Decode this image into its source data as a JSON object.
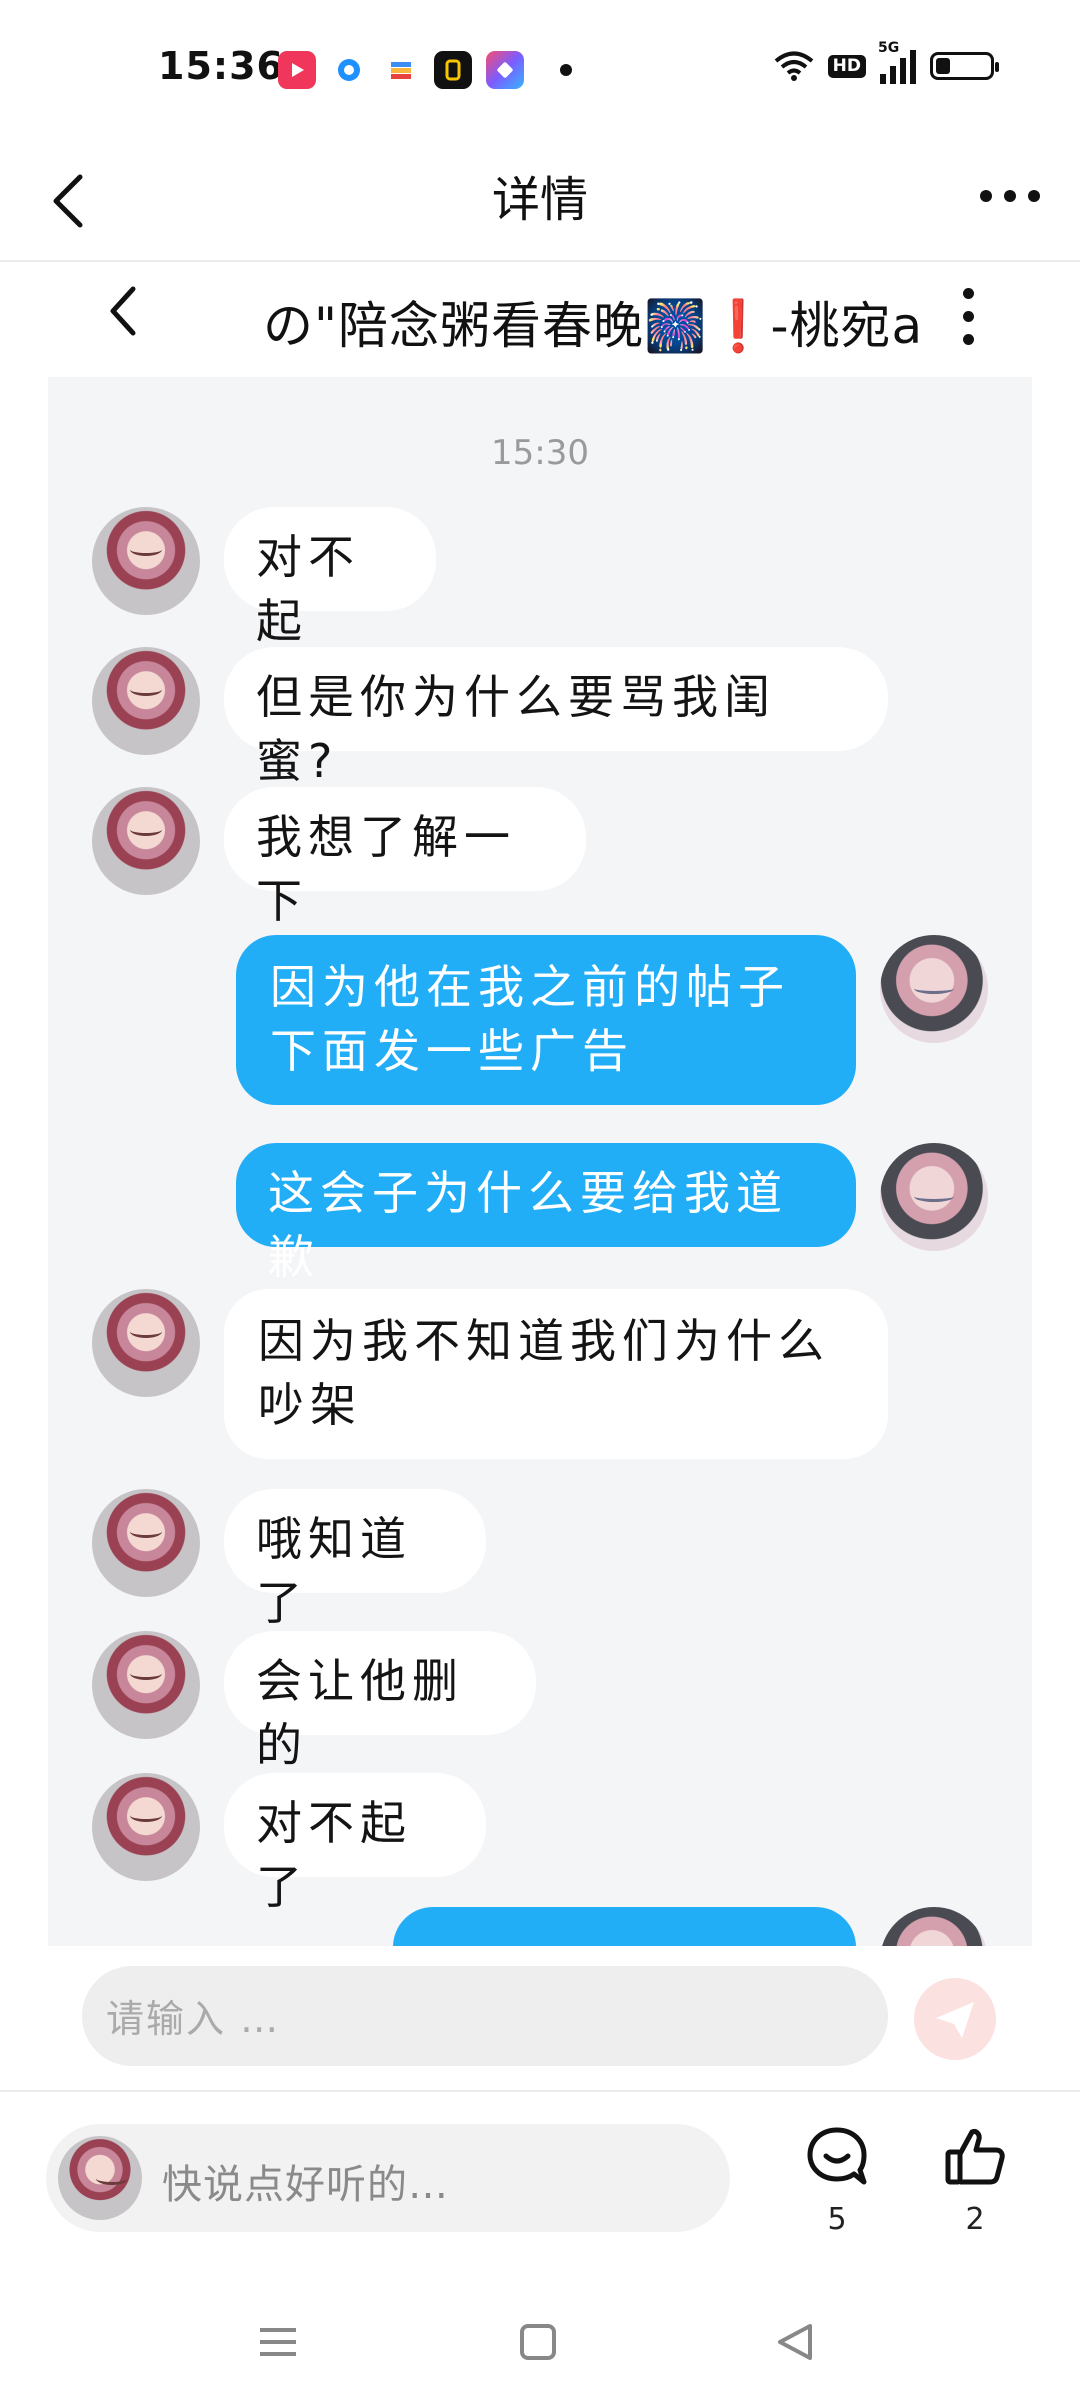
{
  "status_bar": {
    "time": "15:36",
    "network": "5G",
    "hd": "HD",
    "app_icons": [
      "video-app-icon",
      "browser-app-icon",
      "wallet-app-icon",
      "black-app-icon",
      "shortcut-app-icon"
    ],
    "icons": [
      "wifi-icon",
      "signal-icon",
      "battery-icon"
    ]
  },
  "nav": {
    "title": "详情",
    "back_icon": "chevron-left-icon",
    "more_icon": "more-horizontal-icon"
  },
  "screenshot": {
    "header": {
      "title": "の\"陪念粥看春晚🎆❗-桃宛a",
      "back_icon": "chevron-left-icon",
      "more_icon": "more-vertical-icon"
    },
    "timestamp": "15:30",
    "messages": [
      {
        "side": "left",
        "text": "对不起"
      },
      {
        "side": "left",
        "text": "但是你为什么要骂我闺蜜?"
      },
      {
        "side": "left",
        "text": "我想了解一下"
      },
      {
        "side": "right",
        "text": "因为他在我之前的帖子下面发一些广告"
      },
      {
        "side": "right",
        "text": "这会子为什么要给我道歉"
      },
      {
        "side": "left",
        "text": "因为我不知道我们为什么吵架"
      },
      {
        "side": "left",
        "text": "哦知道了"
      },
      {
        "side": "left",
        "text": "会让他删的"
      },
      {
        "side": "left",
        "text": "对不起了"
      },
      {
        "side": "right",
        "text": ""
      }
    ],
    "input_placeholder": "请输入 …"
  },
  "comment_bar": {
    "placeholder": "快说点好听的…",
    "comment_count": "5",
    "like_count": "2",
    "comment_icon": "comment-icon",
    "like_icon": "thumbs-up-icon"
  },
  "system_nav": {
    "icons": [
      "menu-icon",
      "home-icon",
      "back-triangle-icon"
    ]
  },
  "colors": {
    "bubble_right": "#22aef7",
    "bubble_left": "#ffffff",
    "chat_bg": "#f4f5f7"
  }
}
